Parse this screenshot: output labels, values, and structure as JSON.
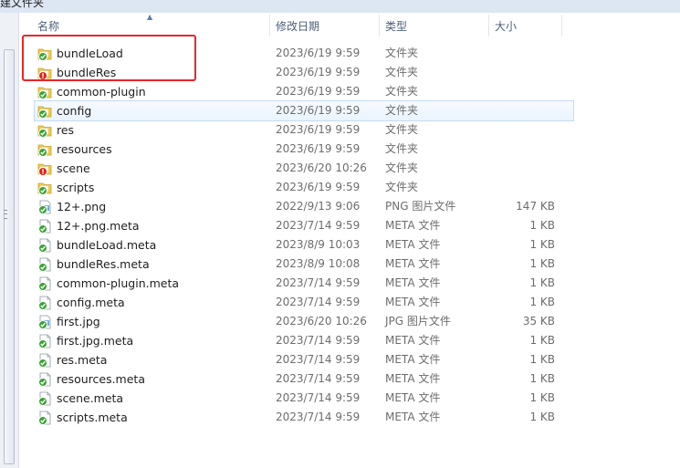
{
  "window": {
    "partial_title": "建文件夹"
  },
  "columns": {
    "name": "名称",
    "date": "修改日期",
    "type": "类型",
    "size": "大小"
  },
  "files": [
    {
      "name": "bundleLoad",
      "date": "2023/6/19 9:59",
      "type": "文件夹",
      "size": "",
      "icon": "folder-synced-icon",
      "status": "ok"
    },
    {
      "name": "bundleRes",
      "date": "2023/6/19 9:59",
      "type": "文件夹",
      "size": "",
      "icon": "folder-conflict-icon",
      "status": "error"
    },
    {
      "name": "common-plugin",
      "date": "2023/6/19 9:59",
      "type": "文件夹",
      "size": "",
      "icon": "folder-synced-icon",
      "status": "ok"
    },
    {
      "name": "config",
      "date": "2023/6/19 9:59",
      "type": "文件夹",
      "size": "",
      "icon": "folder-synced-icon",
      "status": "ok"
    },
    {
      "name": "res",
      "date": "2023/6/19 9:59",
      "type": "文件夹",
      "size": "",
      "icon": "folder-synced-icon",
      "status": "ok"
    },
    {
      "name": "resources",
      "date": "2023/6/19 9:59",
      "type": "文件夹",
      "size": "",
      "icon": "folder-synced-icon",
      "status": "ok"
    },
    {
      "name": "scene",
      "date": "2023/6/20 10:26",
      "type": "文件夹",
      "size": "",
      "icon": "folder-conflict-icon",
      "status": "error"
    },
    {
      "name": "scripts",
      "date": "2023/6/19 9:59",
      "type": "文件夹",
      "size": "",
      "icon": "folder-synced-icon",
      "status": "ok"
    },
    {
      "name": "12+.png",
      "date": "2022/9/13 9:06",
      "type": "PNG 图片文件",
      "size": "147 KB",
      "icon": "image-file-synced-icon",
      "status": "ok"
    },
    {
      "name": "12+.png.meta",
      "date": "2023/7/14 9:59",
      "type": "META 文件",
      "size": "1 KB",
      "icon": "file-synced-icon",
      "status": "ok"
    },
    {
      "name": "bundleLoad.meta",
      "date": "2023/8/9 10:03",
      "type": "META 文件",
      "size": "1 KB",
      "icon": "file-synced-icon",
      "status": "ok"
    },
    {
      "name": "bundleRes.meta",
      "date": "2023/8/9 10:08",
      "type": "META 文件",
      "size": "1 KB",
      "icon": "file-synced-icon",
      "status": "ok"
    },
    {
      "name": "common-plugin.meta",
      "date": "2023/7/14 9:59",
      "type": "META 文件",
      "size": "1 KB",
      "icon": "file-synced-icon",
      "status": "ok"
    },
    {
      "name": "config.meta",
      "date": "2023/7/14 9:59",
      "type": "META 文件",
      "size": "1 KB",
      "icon": "file-synced-icon",
      "status": "ok"
    },
    {
      "name": "first.jpg",
      "date": "2023/6/20 10:26",
      "type": "JPG 图片文件",
      "size": "35 KB",
      "icon": "image-file-synced-icon",
      "status": "ok"
    },
    {
      "name": "first.jpg.meta",
      "date": "2023/7/14 9:59",
      "type": "META 文件",
      "size": "1 KB",
      "icon": "file-synced-icon",
      "status": "ok"
    },
    {
      "name": "res.meta",
      "date": "2023/7/14 9:59",
      "type": "META 文件",
      "size": "1 KB",
      "icon": "file-synced-icon",
      "status": "ok"
    },
    {
      "name": "resources.meta",
      "date": "2023/7/14 9:59",
      "type": "META 文件",
      "size": "1 KB",
      "icon": "file-synced-icon",
      "status": "ok"
    },
    {
      "name": "scene.meta",
      "date": "2023/7/14 9:59",
      "type": "META 文件",
      "size": "1 KB",
      "icon": "file-synced-icon",
      "status": "ok"
    },
    {
      "name": "scripts.meta",
      "date": "2023/7/14 9:59",
      "type": "META 文件",
      "size": "1 KB",
      "icon": "file-synced-icon",
      "status": "ok"
    }
  ],
  "selected_index": 3,
  "colors": {
    "ok_badge": "#3aa335",
    "error_badge": "#d9261c",
    "folder": "#f2c94c",
    "annotation": "#e8262a"
  }
}
